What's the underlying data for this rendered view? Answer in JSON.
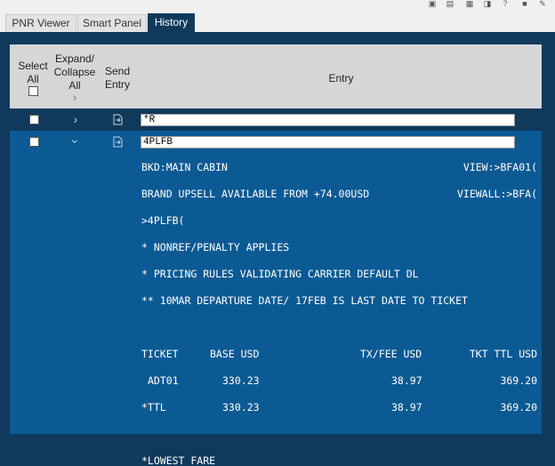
{
  "tabs": [
    {
      "label": "PNR Viewer"
    },
    {
      "label": "Smart Panel"
    },
    {
      "label": "History"
    }
  ],
  "header": {
    "select_all": "Select All",
    "expand_collapse": "Expand/ Collapse All",
    "send_entry": "Send Entry",
    "entry": "Entry"
  },
  "rows": [
    {
      "entry": "*R",
      "expanded": false
    },
    {
      "entry": "4PLFB",
      "expanded": true
    }
  ],
  "response": {
    "bkd": "BKD:MAIN CABIN",
    "view": "VIEW:>BFA01(",
    "brand": "BRAND UPSELL AVAILABLE FROM +74.00USD",
    "viewall": "VIEWALL:>BFA(",
    "cmd": ">4PLFB(",
    "nonref": "* NONREF/PENALTY APPLIES",
    "pricing": "* PRICING RULES VALIDATING CARRIER DEFAULT DL",
    "departure": "** 10MAR DEPARTURE DATE/ 17FEB IS LAST DATE TO TICKET",
    "table_header": {
      "ticket": "TICKET",
      "base": "BASE USD",
      "tax": "TX/FEE USD",
      "total": "TKT TTL USD"
    },
    "table_rows": [
      {
        "ticket": "ADT01",
        "base": "330.23",
        "tax": "38.97",
        "total": "369.20"
      },
      {
        "ticket": "*TTL",
        "base": "330.23",
        "tax": "38.97",
        "total": "369.20"
      }
    ],
    "lowest": "*LOWEST FARE"
  },
  "icons": [
    "copy-icon",
    "phone-icon",
    "print-icon",
    "export-icon",
    "help-icon",
    "lock-icon",
    "settings-icon"
  ],
  "colors": {
    "panel": "#0f3a5c",
    "content": "#0b5a94",
    "header": "#d6d6d6"
  }
}
